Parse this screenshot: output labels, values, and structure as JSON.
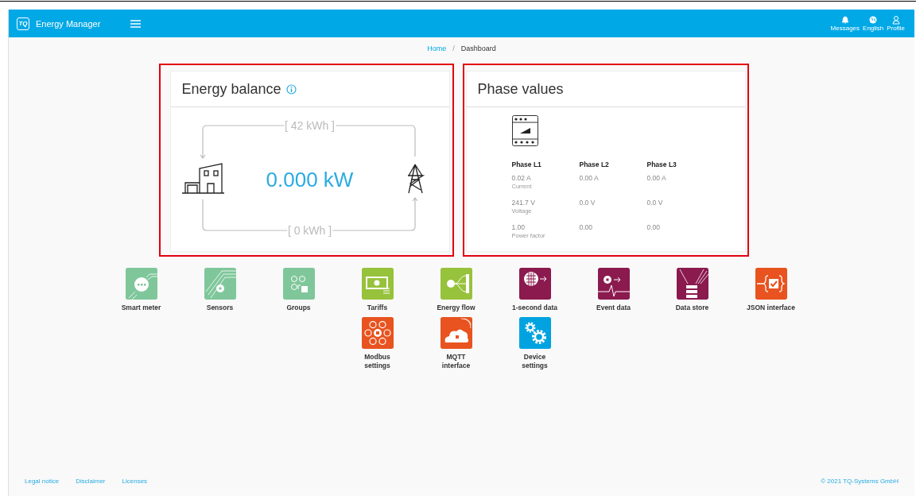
{
  "header": {
    "logo": "TQ",
    "title": "Energy Manager",
    "actions": [
      {
        "label": "Messages"
      },
      {
        "label": "English"
      },
      {
        "label": "Profile"
      }
    ]
  },
  "breadcrumb": [
    {
      "label": "Home",
      "selected": false
    },
    {
      "label": "/",
      "selected": false
    },
    {
      "label": "Dashboard",
      "selected": true
    }
  ],
  "energy_balance": {
    "title": "Energy balance",
    "highlighted": true,
    "import": "[ 42 kWh ]",
    "power": "0.000 kW",
    "export": "[ 0 kWh ]"
  },
  "phase_values": {
    "title": "Phase values",
    "highlighted": true,
    "phases": [
      "Phase L1",
      "Phase L2",
      "Phase L3"
    ],
    "rows": [
      {
        "values": [
          "0.02 A",
          "0.00 A",
          "0.00 A"
        ],
        "caption": "Current"
      },
      {
        "values": [
          "241.7 V",
          "0.0 V",
          "0.0 V"
        ],
        "caption": "Voltage"
      },
      {
        "values": [
          "1.00",
          "0.00",
          "0.00"
        ],
        "caption": "Power factor"
      }
    ]
  },
  "tiles": [
    {
      "label": "Smart meter",
      "color": "#7fc79b"
    },
    {
      "label": "Sensors",
      "color": "#7fc79b"
    },
    {
      "label": "Groups",
      "color": "#7fc79b"
    },
    {
      "label": "Tariffs",
      "color": "#97c23c"
    },
    {
      "label": "Energy flow",
      "color": "#97c23c"
    },
    {
      "label": "1-second data",
      "color": "#8b1a4f"
    },
    {
      "label": "Event data",
      "color": "#8b1a4f"
    },
    {
      "label": "Data store",
      "color": "#8b1a4f"
    },
    {
      "label": "JSON interface",
      "color": "#e8531f"
    },
    {
      "label": "Modbus settings",
      "color": "#e8531f"
    },
    {
      "label": "MQTT interface",
      "color": "#e8531f"
    },
    {
      "label": "Device settings",
      "color": "#00a3e0"
    }
  ],
  "footer": {
    "links": [
      "Legal notice",
      "Disclaimer",
      "Licenses"
    ],
    "copyright": "© 2021 TQ-Systems GmbH"
  }
}
